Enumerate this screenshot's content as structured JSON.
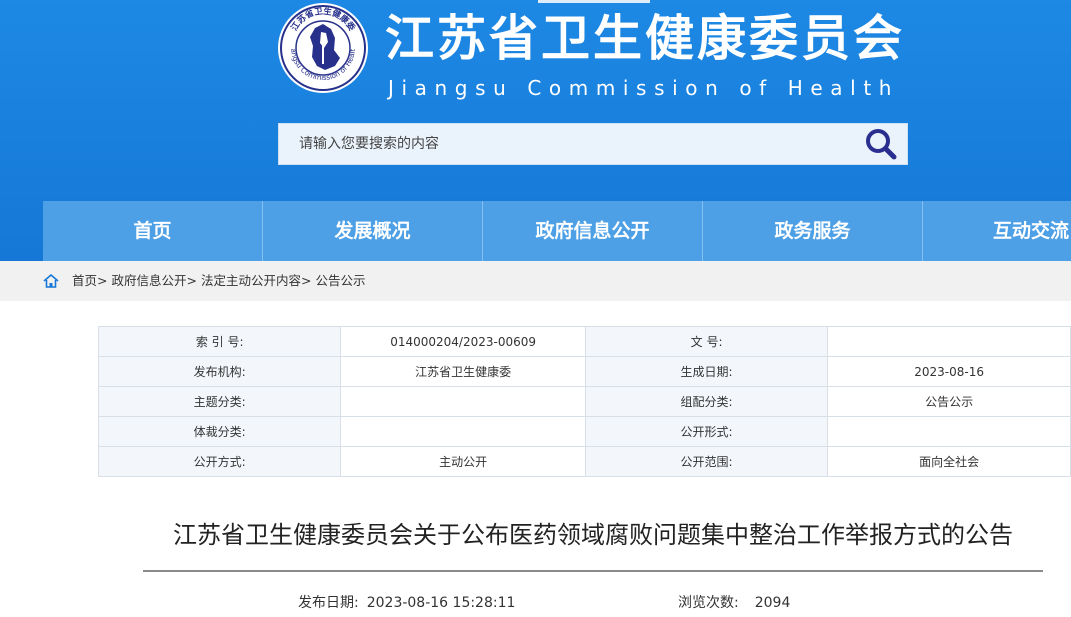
{
  "header": {
    "title": "江苏省卫生健康委员会",
    "subtitle": "Jiangsu Commission of Health",
    "logo_ring_text": "Jiangsu Commission of Health",
    "logo_top_text": "江苏省卫生健康委",
    "colors": {
      "background": "#1677d6",
      "nav": "#4d9fe6",
      "search_bg": "#eaf3fc",
      "search_icon": "#2a2f8f"
    }
  },
  "search": {
    "placeholder": "请输入您要搜索的内容",
    "icon": "search-icon"
  },
  "nav": {
    "items": [
      "首页",
      "发展概况",
      "政府信息公开",
      "政务服务",
      "互动交流"
    ]
  },
  "breadcrumb": {
    "icon": "home-icon",
    "items": [
      "首页",
      "政府信息公开",
      "法定主动公开内容",
      "公告公示"
    ],
    "separator": ">"
  },
  "info_table": {
    "rows": [
      [
        {
          "label": "索 引 号:",
          "value": "014000204/2023-00609"
        },
        {
          "label": "文      号:",
          "value": ""
        }
      ],
      [
        {
          "label": "发布机构:",
          "value": "江苏省卫生健康委"
        },
        {
          "label": "生成日期:",
          "value": "2023-08-16"
        }
      ],
      [
        {
          "label": "主题分类:",
          "value": ""
        },
        {
          "label": "组配分类:",
          "value": "公告公示"
        }
      ],
      [
        {
          "label": "体裁分类:",
          "value": ""
        },
        {
          "label": "公开形式:",
          "value": ""
        }
      ],
      [
        {
          "label": "公开方式:",
          "value": "主动公开"
        },
        {
          "label": "公开范围:",
          "value": "面向全社会"
        }
      ]
    ]
  },
  "article": {
    "title": "江苏省卫生健康委员会关于公布医药领域腐败问题集中整治工作举报方式的公告",
    "publish_label": "发布日期:",
    "publish_date": "2023-08-16 15:28:11",
    "views_label": "浏览次数:",
    "views": "2094"
  }
}
